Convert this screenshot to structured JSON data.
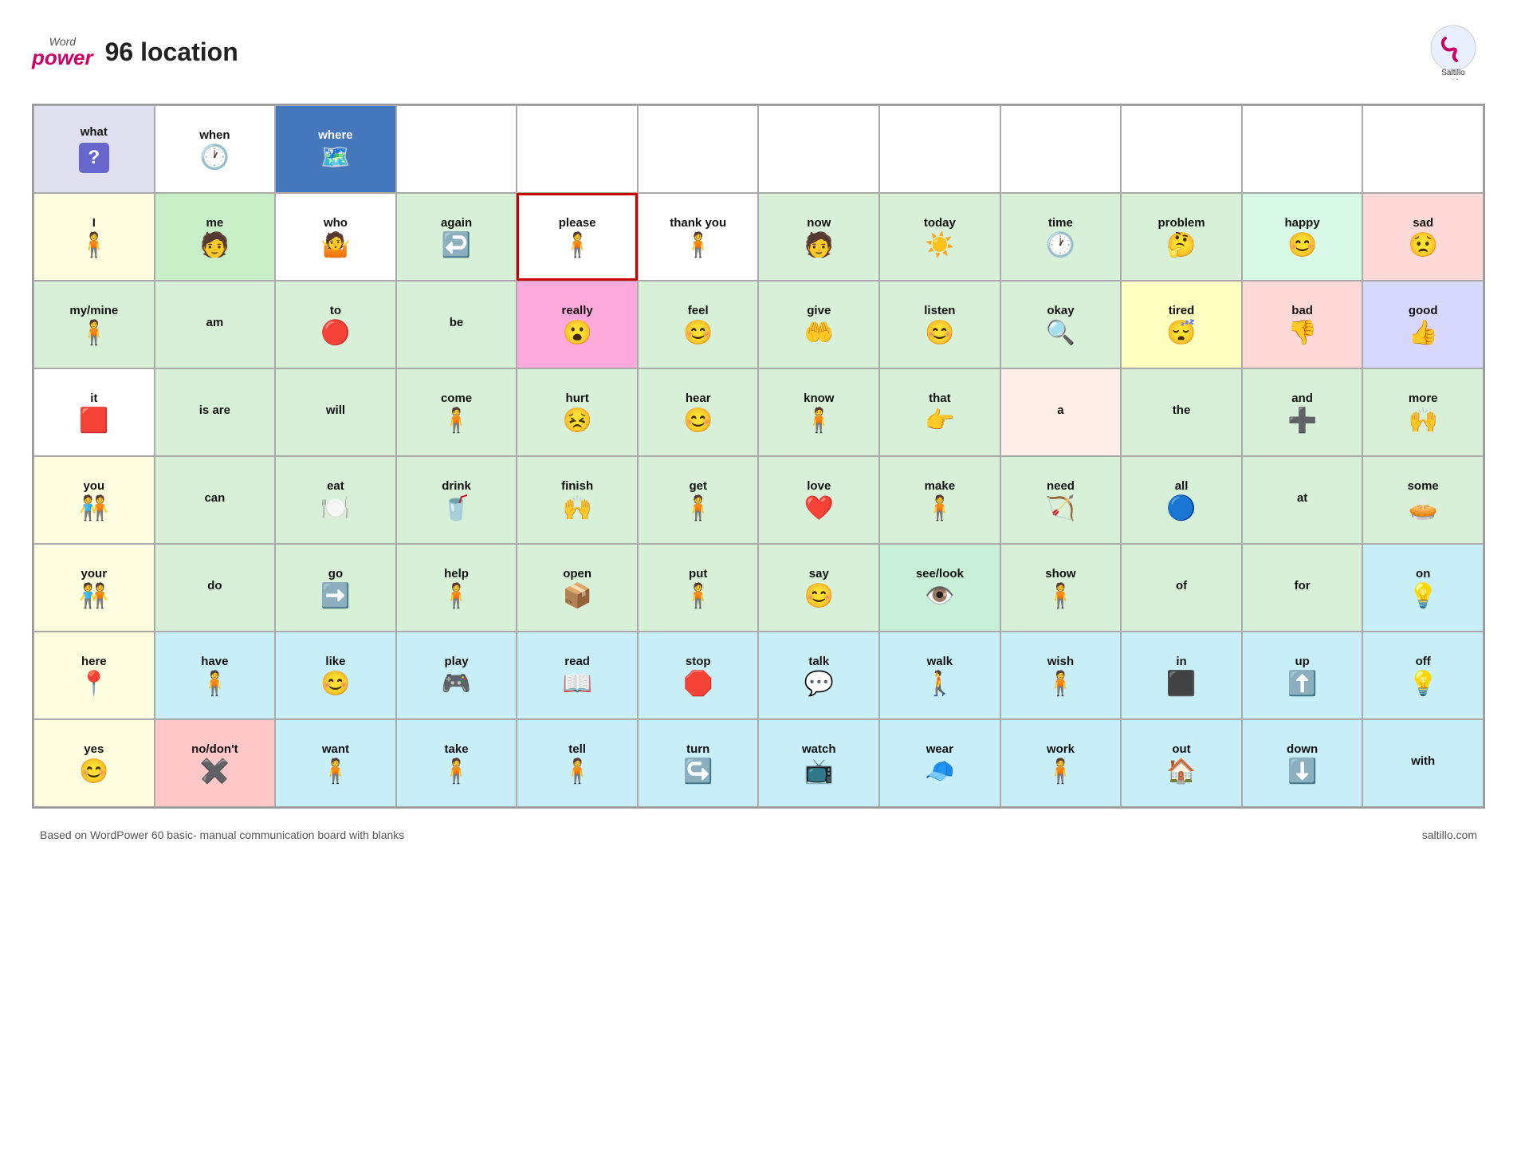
{
  "header": {
    "logo_word": "Word",
    "logo_power": "power",
    "title": "96 location",
    "saltillo_text": "Saltillo",
    "saltillo_url": "www.saltillo.com"
  },
  "footer": {
    "left_text": "Based on WordPower 60 basic- manual communication board with blanks",
    "right_text": "saltillo.com"
  },
  "grid": {
    "rows": [
      [
        {
          "label": "what",
          "icon": "❓",
          "bg": "#e0e0f0",
          "border": ""
        },
        {
          "label": "when",
          "icon": "🕐",
          "bg": "#ffffff",
          "border": ""
        },
        {
          "label": "where",
          "icon": "🗺️",
          "bg": "#4477bb",
          "label_color": "#fff",
          "border": ""
        },
        {
          "label": "",
          "icon": "",
          "bg": "#ffffff",
          "border": ""
        },
        {
          "label": "",
          "icon": "",
          "bg": "#ffffff",
          "border": ""
        },
        {
          "label": "",
          "icon": "",
          "bg": "#ffffff",
          "border": ""
        },
        {
          "label": "",
          "icon": "",
          "bg": "#ffffff",
          "border": ""
        },
        {
          "label": "",
          "icon": "",
          "bg": "#ffffff",
          "border": ""
        },
        {
          "label": "",
          "icon": "",
          "bg": "#ffffff",
          "border": ""
        },
        {
          "label": "",
          "icon": "",
          "bg": "#ffffff",
          "border": ""
        },
        {
          "label": "",
          "icon": "",
          "bg": "#ffffff",
          "border": ""
        },
        {
          "label": "",
          "icon": "",
          "bg": "#ffffff",
          "border": ""
        }
      ],
      [
        {
          "label": "I",
          "icon": "🧍",
          "bg": "#fffde0",
          "border": ""
        },
        {
          "label": "me",
          "icon": "🧑",
          "bg": "#b8e8b8",
          "border": ""
        },
        {
          "label": "who",
          "icon": "🤷",
          "bg": "#ffffff",
          "border": ""
        },
        {
          "label": "again",
          "icon": "↩️",
          "bg": "#d8f0d8",
          "border": ""
        },
        {
          "label": "please",
          "icon": "🧍",
          "bg": "#ffffff",
          "border": "3px solid #cc0000"
        },
        {
          "label": "thank you",
          "icon": "🧍",
          "bg": "#ffffff",
          "border": ""
        },
        {
          "label": "now",
          "icon": "🧑",
          "bg": "#d8f0d8",
          "border": ""
        },
        {
          "label": "today",
          "icon": "☀️",
          "bg": "#d8f0d8",
          "border": ""
        },
        {
          "label": "time",
          "icon": "🕐",
          "bg": "#d8f0d8",
          "border": ""
        },
        {
          "label": "problem",
          "icon": "🤔",
          "bg": "#d8f0d8",
          "border": ""
        },
        {
          "label": "happy",
          "icon": "😊",
          "bg": "#d8f8e8",
          "border": ""
        },
        {
          "label": "sad",
          "icon": "😟",
          "bg": "#ffd8d8",
          "border": ""
        }
      ],
      [
        {
          "label": "my/mine",
          "icon": "🧍",
          "bg": "#d8f0d8",
          "border": ""
        },
        {
          "label": "am",
          "icon": "",
          "bg": "#d8f0d8",
          "border": ""
        },
        {
          "label": "to",
          "icon": "🔴",
          "bg": "#d8f0d8",
          "border": ""
        },
        {
          "label": "be",
          "icon": "",
          "bg": "#d8f0d8",
          "border": ""
        },
        {
          "label": "really",
          "icon": "😮",
          "bg": "#ffaadd",
          "border": ""
        },
        {
          "label": "feel",
          "icon": "😊",
          "bg": "#d8f0d8",
          "border": ""
        },
        {
          "label": "give",
          "icon": "🤲",
          "bg": "#d8f0d8",
          "border": ""
        },
        {
          "label": "listen",
          "icon": "😊",
          "bg": "#d8f0d8",
          "border": ""
        },
        {
          "label": "okay",
          "icon": "🔍",
          "bg": "#d8f0d8",
          "border": ""
        },
        {
          "label": "tired",
          "icon": "😴",
          "bg": "#ffffc0",
          "border": ""
        },
        {
          "label": "bad",
          "icon": "👎",
          "bg": "#ffd8d8",
          "border": ""
        },
        {
          "label": "good",
          "icon": "👍",
          "bg": "#d8d8ff",
          "border": ""
        }
      ],
      [
        {
          "label": "it",
          "icon": "🟥",
          "bg": "#ffffff",
          "border": ""
        },
        {
          "label": "is\nare",
          "icon": "",
          "bg": "#d8f0d8",
          "border": ""
        },
        {
          "label": "will",
          "icon": "",
          "bg": "#d8f0d8",
          "border": ""
        },
        {
          "label": "come",
          "icon": "🧍",
          "bg": "#d8f0d8",
          "border": ""
        },
        {
          "label": "hurt",
          "icon": "😣",
          "bg": "#d8f0d8",
          "border": ""
        },
        {
          "label": "hear",
          "icon": "😊",
          "bg": "#d8f0d8",
          "border": ""
        },
        {
          "label": "know",
          "icon": "🧍",
          "bg": "#d8f0d8",
          "border": ""
        },
        {
          "label": "that",
          "icon": "👉",
          "bg": "#d8f0d8",
          "border": ""
        },
        {
          "label": "a",
          "icon": "",
          "bg": "#ffeee8",
          "border": ""
        },
        {
          "label": "the",
          "icon": "",
          "bg": "#d8f0d8",
          "border": ""
        },
        {
          "label": "and",
          "icon": "➕",
          "bg": "#d8f0d8",
          "border": ""
        },
        {
          "label": "more",
          "icon": "🙌",
          "bg": "#d8f0d8",
          "border": ""
        }
      ],
      [
        {
          "label": "you",
          "icon": "🧑‍🤝‍🧑",
          "bg": "#fffde0",
          "border": ""
        },
        {
          "label": "can",
          "icon": "",
          "bg": "#d8f0d8",
          "border": ""
        },
        {
          "label": "eat",
          "icon": "🍽️",
          "bg": "#d8f0d8",
          "border": ""
        },
        {
          "label": "drink",
          "icon": "🥤",
          "bg": "#d8f0d8",
          "border": ""
        },
        {
          "label": "finish",
          "icon": "🙌",
          "bg": "#d8f0d8",
          "border": ""
        },
        {
          "label": "get",
          "icon": "🧍",
          "bg": "#d8f0d8",
          "border": ""
        },
        {
          "label": "love",
          "icon": "❤️",
          "bg": "#d8f0d8",
          "border": ""
        },
        {
          "label": "make",
          "icon": "🧍",
          "bg": "#d8f0d8",
          "border": ""
        },
        {
          "label": "need",
          "icon": "🏹",
          "bg": "#d8f0d8",
          "border": ""
        },
        {
          "label": "all",
          "icon": "🔵",
          "bg": "#d8f0d8",
          "border": ""
        },
        {
          "label": "at",
          "icon": "",
          "bg": "#d8f0d8",
          "border": ""
        },
        {
          "label": "some",
          "icon": "🥧",
          "bg": "#d8f0d8",
          "border": ""
        }
      ],
      [
        {
          "label": "your",
          "icon": "🧑‍🤝‍🧑",
          "bg": "#fffde0",
          "border": ""
        },
        {
          "label": "do",
          "icon": "",
          "bg": "#d8f0d8",
          "border": ""
        },
        {
          "label": "go",
          "icon": "➡️",
          "bg": "#d8f0d8",
          "border": ""
        },
        {
          "label": "help",
          "icon": "🧍",
          "bg": "#d8f0d8",
          "border": ""
        },
        {
          "label": "open",
          "icon": "📦",
          "bg": "#d8f0d8",
          "border": ""
        },
        {
          "label": "put",
          "icon": "🧍",
          "bg": "#d8f0d8",
          "border": ""
        },
        {
          "label": "say",
          "icon": "😊",
          "bg": "#d8f0d8",
          "border": ""
        },
        {
          "label": "see/look",
          "icon": "👁️",
          "bg": "#c8f0d8",
          "border": ""
        },
        {
          "label": "show",
          "icon": "🧍",
          "bg": "#d8f0d8",
          "border": ""
        },
        {
          "label": "of",
          "icon": "",
          "bg": "#d8f0d8",
          "border": ""
        },
        {
          "label": "for",
          "icon": "",
          "bg": "#d8f0d8",
          "border": ""
        },
        {
          "label": "on",
          "icon": "💡",
          "bg": "#c8eef8",
          "border": ""
        }
      ],
      [
        {
          "label": "here",
          "icon": "📍",
          "bg": "#fffde0",
          "border": ""
        },
        {
          "label": "have",
          "icon": "🧍",
          "bg": "#c8eef8",
          "border": ""
        },
        {
          "label": "like",
          "icon": "😊",
          "bg": "#c8eef8",
          "border": ""
        },
        {
          "label": "play",
          "icon": "🎮",
          "bg": "#c8eef8",
          "border": ""
        },
        {
          "label": "read",
          "icon": "📖",
          "bg": "#c8eef8",
          "border": ""
        },
        {
          "label": "stop",
          "icon": "🛑",
          "bg": "#c8eef8",
          "border": ""
        },
        {
          "label": "talk",
          "icon": "💬",
          "bg": "#c8eef8",
          "border": ""
        },
        {
          "label": "walk",
          "icon": "🚶",
          "bg": "#c8eef8",
          "border": ""
        },
        {
          "label": "wish",
          "icon": "🧍",
          "bg": "#c8eef8",
          "border": ""
        },
        {
          "label": "in",
          "icon": "⬛",
          "bg": "#c8eef8",
          "border": ""
        },
        {
          "label": "up",
          "icon": "⬆️",
          "bg": "#c8eef8",
          "border": ""
        },
        {
          "label": "off",
          "icon": "💡",
          "bg": "#c8eef8",
          "border": ""
        }
      ],
      [
        {
          "label": "yes",
          "icon": "😊",
          "bg": "#fffde0",
          "border": ""
        },
        {
          "label": "no/don't",
          "icon": "✖️",
          "bg": "#ffc8c8",
          "border": ""
        },
        {
          "label": "want",
          "icon": "🧍",
          "bg": "#c8eef8",
          "border": ""
        },
        {
          "label": "take",
          "icon": "🧍",
          "bg": "#c8eef8",
          "border": ""
        },
        {
          "label": "tell",
          "icon": "🧍",
          "bg": "#c8eef8",
          "border": ""
        },
        {
          "label": "turn",
          "icon": "↪️",
          "bg": "#c8eef8",
          "border": ""
        },
        {
          "label": "watch",
          "icon": "📺",
          "bg": "#c8eef8",
          "border": ""
        },
        {
          "label": "wear",
          "icon": "🧢",
          "bg": "#c8eef8",
          "border": ""
        },
        {
          "label": "work",
          "icon": "🧍",
          "bg": "#c8eef8",
          "border": ""
        },
        {
          "label": "out",
          "icon": "🏠",
          "bg": "#c8eef8",
          "border": ""
        },
        {
          "label": "down",
          "icon": "⬇️",
          "bg": "#c8eef8",
          "border": ""
        },
        {
          "label": "with",
          "icon": "",
          "bg": "#c8eef8",
          "border": ""
        }
      ]
    ]
  }
}
